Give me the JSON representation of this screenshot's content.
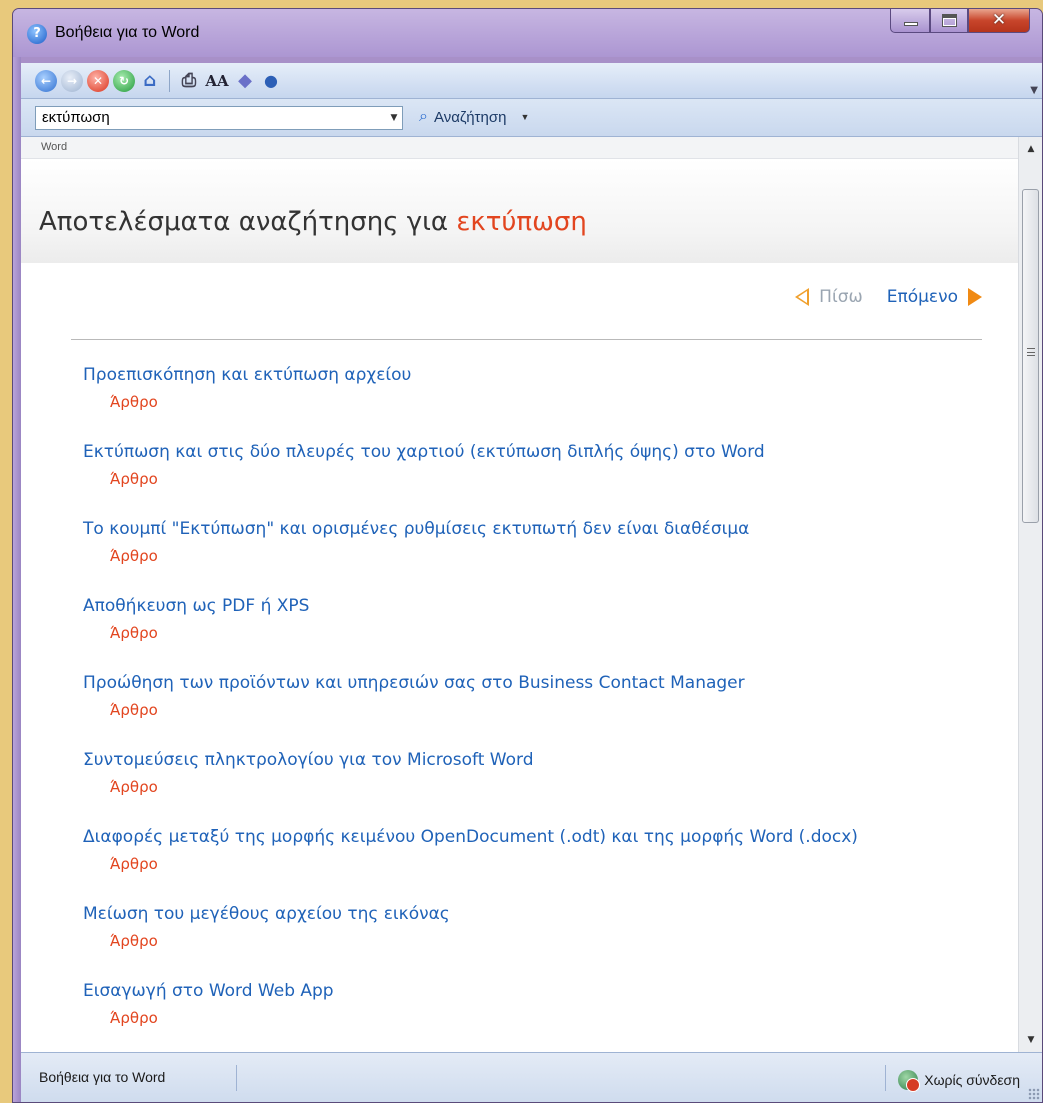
{
  "window": {
    "title": "Βοήθεια για το Word"
  },
  "toolbar": {
    "back": "back-icon",
    "forward": "forward-icon",
    "stop": "stop-icon",
    "refresh": "refresh-icon",
    "home": "home-icon",
    "print": "print-icon",
    "font_size_label": "AA",
    "toc": "book-icon",
    "keep_on_top": "pin-icon"
  },
  "search": {
    "value": "εκτύπωση",
    "button_label": "Αναζήτηση"
  },
  "breadcrumb": "Word",
  "results_header": {
    "prefix": "Αποτελέσματα αναζήτησης για",
    "query": "εκτύπωση"
  },
  "pager": {
    "prev_label": "Πίσω",
    "next_label": "Επόμενο"
  },
  "results": [
    {
      "title": "Προεπισκόπηση και εκτύπωση αρχείου",
      "type": "Άρθρο"
    },
    {
      "title": "Εκτύπωση και στις δύο πλευρές του χαρτιού (εκτύπωση διπλής όψης) στο Word",
      "type": "Άρθρο"
    },
    {
      "title": "Το κουμπί \"Εκτύπωση\" και ορισμένες ρυθμίσεις εκτυπωτή δεν είναι διαθέσιμα",
      "type": "Άρθρο"
    },
    {
      "title": "Αποθήκευση ως PDF ή XPS",
      "type": "Άρθρο"
    },
    {
      "title": "Προώθηση των προϊόντων και υπηρεσιών σας στο Business Contact Manager",
      "type": "Άρθρο"
    },
    {
      "title": "Συντομεύσεις πληκτρολογίου για τον Microsoft Word",
      "type": "Άρθρο"
    },
    {
      "title": "Διαφορές μεταξύ της μορφής κειμένου OpenDocument (.odt) και της μορφής Word (.docx)",
      "type": "Άρθρο"
    },
    {
      "title": "Μείωση του μεγέθους αρχείου της εικόνας",
      "type": "Άρθρο"
    },
    {
      "title": "Εισαγωγή στο Word Web App",
      "type": "Άρθρο"
    }
  ],
  "status": {
    "left": "Βοήθεια για το Word",
    "connection": "Χωρίς σύνδεση"
  }
}
